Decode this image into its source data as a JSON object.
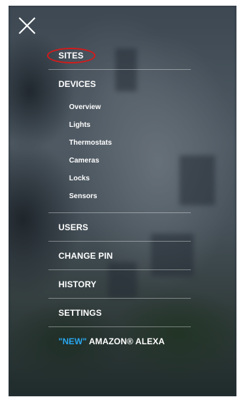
{
  "menu": {
    "close_icon": "close-icon",
    "sites": "SITES",
    "devices": {
      "label": "DEVICES",
      "items": [
        "Overview",
        "Lights",
        "Thermostats",
        "Cameras",
        "Locks",
        "Sensors"
      ]
    },
    "users": "USERS",
    "change_pin": "CHANGE PIN",
    "history": "HISTORY",
    "settings": "SETTINGS",
    "alexa": {
      "new_tag": "\"NEW\"",
      "label": " AMAZON® ALEXA"
    },
    "highlight_color": "#d51a1a",
    "accent_color": "#2aa7f0"
  }
}
